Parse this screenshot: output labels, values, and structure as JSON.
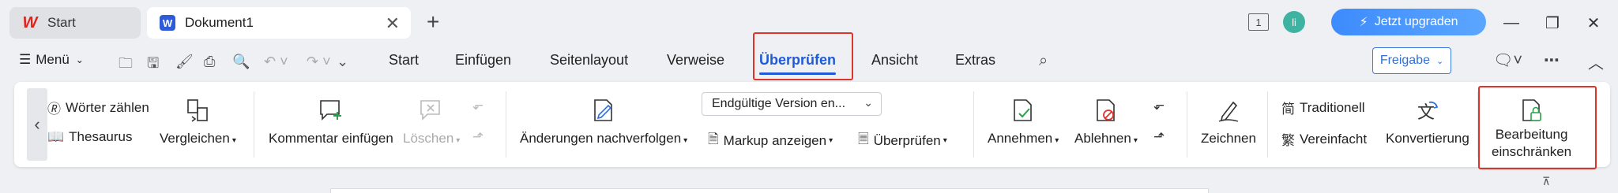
{
  "titlebar": {
    "tabs": [
      {
        "label": "Start",
        "active": false
      },
      {
        "label": "Dokument1",
        "active": true
      }
    ],
    "doc_count": "1",
    "avatar_initial": "li",
    "upgrade_label": "Jetzt upgraden"
  },
  "menubar": {
    "menu_label": "Menü",
    "tabs": [
      "Start",
      "Einfügen",
      "Seitenlayout",
      "Verweise",
      "Überprüfen",
      "Ansicht",
      "Extras"
    ],
    "active_tab": "Überprüfen",
    "share_label": "Freigabe"
  },
  "ribbon": {
    "proofing": {
      "word_count": "Wörter zählen",
      "thesaurus": "Thesaurus",
      "compare": "Vergleichen"
    },
    "comments": {
      "insert": "Kommentar einfügen",
      "delete": "Löschen"
    },
    "tracking": {
      "track_changes": "Änderungen nachverfolgen",
      "display_select": "Endgültige Version en...",
      "show_markup": "Markup anzeigen",
      "review_pane": "Überprüfen"
    },
    "changes": {
      "accept": "Annehmen",
      "reject": "Ablehnen"
    },
    "ink": {
      "draw": "Zeichnen"
    },
    "chinese": {
      "traditional": "Traditionell",
      "simplified": "Vereinfacht",
      "conversion": "Konvertierung"
    },
    "protect": {
      "restrict_line1": "Bearbeitung",
      "restrict_line2": "einschränken"
    }
  },
  "colors": {
    "accent": "#1f5bd6",
    "highlight": "#e0332c",
    "upgrade": "#3d8bfd"
  }
}
